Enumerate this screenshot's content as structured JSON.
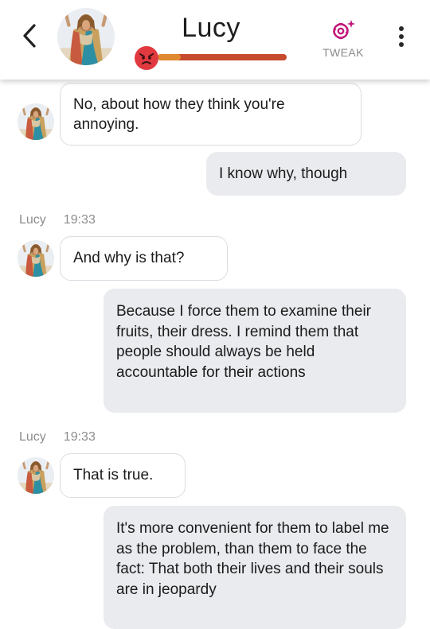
{
  "header": {
    "title": "Lucy",
    "tweak_label": "TWEAK",
    "mood_level": 0.18,
    "colors": {
      "mood_fill": "#e0892f",
      "mood_track": "#c64a2c",
      "tweak_icon": "#c2187a"
    },
    "icons": [
      "back-chevron-icon",
      "angry-face-icon",
      "flower-sparkle-icon",
      "more-vertical-icon"
    ]
  },
  "messages": [
    {
      "sender": "Lucy",
      "direction": "in",
      "text": "No, about how they think you're annoying."
    },
    {
      "sender": "user",
      "direction": "out",
      "text": "I know why, though"
    },
    {
      "sender": "Lucy",
      "time": "19:33",
      "direction": "in",
      "text": "And why is that?"
    },
    {
      "sender": "user",
      "direction": "out",
      "text": "Because I force them to examine their fruits, their dress. I remind them that people should always be held accountable for their actions"
    },
    {
      "sender": "Lucy",
      "time": "19:33",
      "direction": "in",
      "text": "That is true."
    },
    {
      "sender": "user",
      "direction": "out",
      "text": "It's more convenient for them to label me as the problem, than them to face the fact: That both their lives and their souls are in jeopardy"
    }
  ]
}
